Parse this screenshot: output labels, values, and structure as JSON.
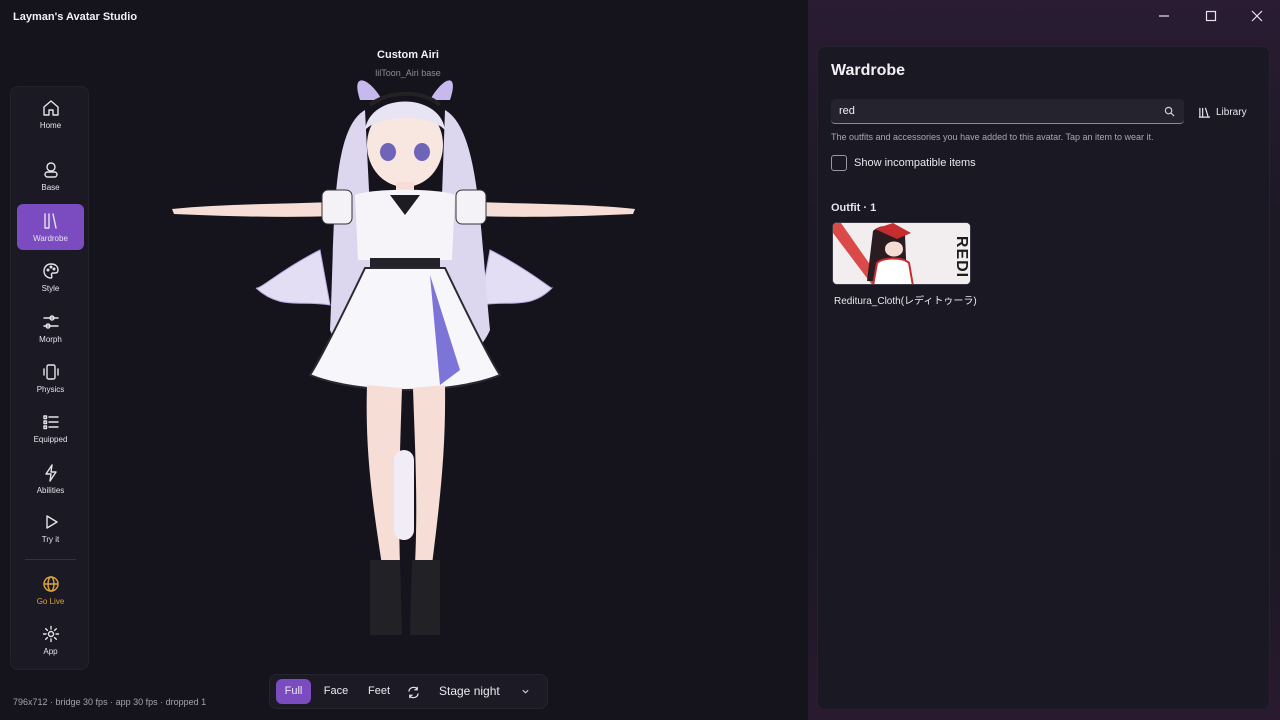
{
  "app": {
    "title": "Layman's Avatar Studio"
  },
  "window_controls": [
    "minimize-icon",
    "maximize-icon",
    "close-icon"
  ],
  "avatar": {
    "name": "Custom Airi",
    "base": "lilToon_Airi base"
  },
  "sidebar": {
    "items": [
      {
        "label": "Home",
        "icon": "home-icon",
        "active": false
      },
      {
        "label": "Base",
        "icon": "user-icon",
        "active": false
      },
      {
        "label": "Wardrobe",
        "icon": "library-icon",
        "active": true
      },
      {
        "label": "Style",
        "icon": "palette-icon",
        "active": false
      },
      {
        "label": "Morph",
        "icon": "sliders-icon",
        "active": false
      },
      {
        "label": "Physics",
        "icon": "vibrate-icon",
        "active": false
      },
      {
        "label": "Equipped",
        "icon": "list-icon",
        "active": false
      },
      {
        "label": "Abilities",
        "icon": "bolt-icon",
        "active": false
      },
      {
        "label": "Try it",
        "icon": "play-icon",
        "active": false
      },
      {
        "label": "Go Live",
        "icon": "globe-icon",
        "active": false
      },
      {
        "label": "App",
        "icon": "gear-icon",
        "active": false
      }
    ]
  },
  "status": {
    "text": "796x712 · bridge 30 fps · app 30 fps · dropped 1"
  },
  "view_bar": {
    "modes": [
      "Full",
      "Face",
      "Feet"
    ],
    "selected_mode": "Full",
    "stage": "Stage night"
  },
  "wardrobe": {
    "title": "Wardrobe",
    "search_value": "red",
    "library_label": "Library",
    "helper_text": "The outfits and accessories you have added to this avatar. Tap an item to wear it.",
    "show_incompatible_label": "Show incompatible items",
    "show_incompatible_checked": false,
    "section_heading": "Outfit · 1",
    "items": [
      {
        "name": "Reditura_Cloth(レディトゥーラ)",
        "thumb_text": "REDI"
      }
    ]
  },
  "colors": {
    "accent": "#7b4cc0",
    "live": "#d9a53a",
    "background": "#14141c"
  }
}
